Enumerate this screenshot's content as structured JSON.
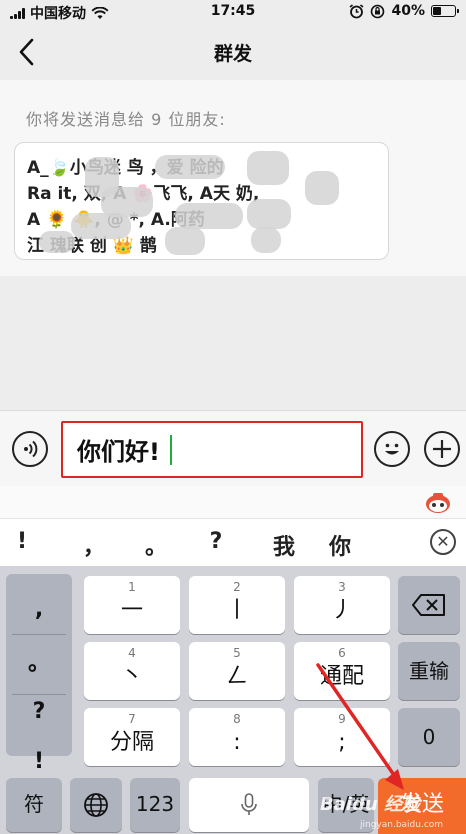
{
  "status_bar": {
    "carrier": "中国移动",
    "time": "17:45",
    "battery": "40%",
    "battery_level": 0.4
  },
  "nav": {
    "title": "群发"
  },
  "recipients": {
    "heading": "你将发送消息给 9 位朋友:",
    "lines": [
      "A_🍃小鸟迷  鸟   ，爱  险的",
      "Ra    it,     双, A 🌸飞飞, A天   奶,",
      "A 🌻      🐥, @     *, A.阿药",
      "江    瑰联    创   👑  鹊"
    ]
  },
  "input": {
    "text": "你们好!"
  },
  "candidates": [
    "!",
    "，",
    "。",
    "?",
    "我",
    "你"
  ],
  "keyboard": {
    "side_keys": [
      ",",
      "。",
      "?",
      "!"
    ],
    "rows": [
      [
        {
          "num": "1",
          "label": "一"
        },
        {
          "num": "2",
          "label": "丨"
        },
        {
          "num": "3",
          "label": "丿"
        }
      ],
      [
        {
          "num": "4",
          "label": "丶"
        },
        {
          "num": "5",
          "label": "ㄥ"
        },
        {
          "num": "6",
          "label": "通配"
        }
      ],
      [
        {
          "num": "7",
          "label": "分隔"
        },
        {
          "num": "8",
          "label": ":"
        },
        {
          "num": "9",
          "label": ";"
        }
      ]
    ],
    "right_keys": {
      "delete": "⌫",
      "retype": "重输",
      "zero": "0"
    },
    "bottom_row": {
      "symbols": "符",
      "globe": "",
      "numbers": "123",
      "lang": "中/英",
      "send": "发送"
    }
  },
  "watermark": {
    "brand": "Baidu 经验",
    "url": "jingyan.baidu.com"
  },
  "colors": {
    "send": "#f36b2a",
    "input_border": "#e02525",
    "caret": "#1fae3a",
    "arrow": "#e02525"
  }
}
